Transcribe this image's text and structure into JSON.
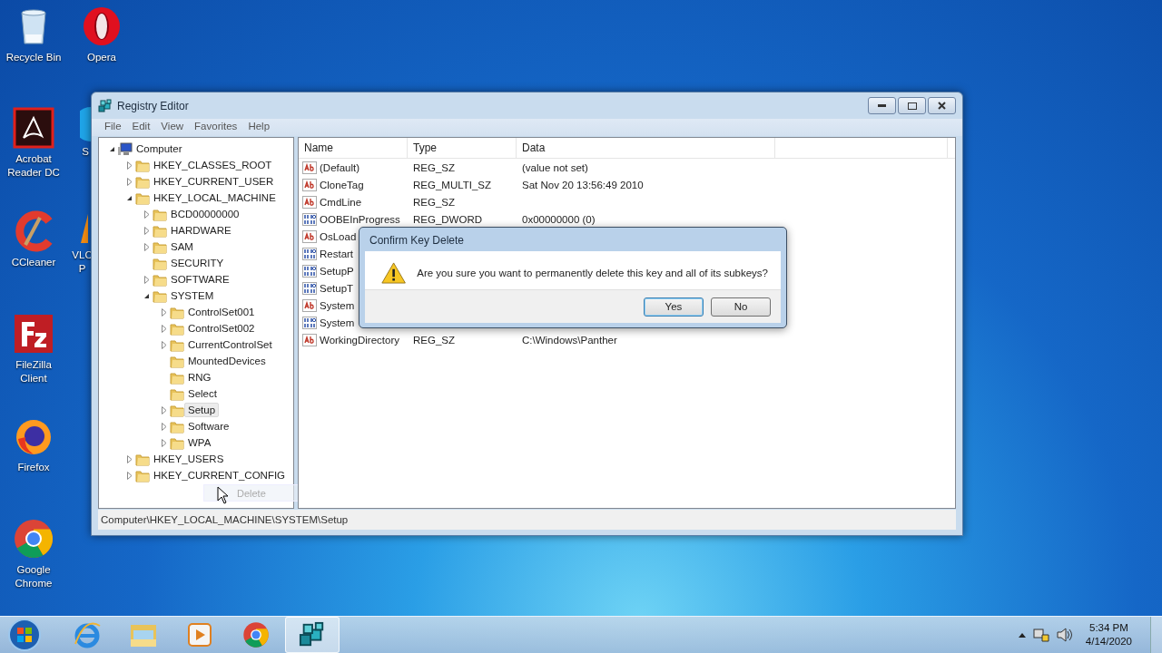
{
  "desktop_icons": [
    {
      "kind": "recycle",
      "lines": [
        "Recycle Bin"
      ]
    },
    {
      "kind": "acrobat",
      "lines": [
        "Acrobat",
        "Reader DC"
      ]
    },
    {
      "kind": "ccleaner",
      "lines": [
        "CCleaner"
      ]
    },
    {
      "kind": "filezilla",
      "lines": [
        "FileZilla",
        "Client"
      ]
    },
    {
      "kind": "firefox",
      "lines": [
        "Firefox"
      ]
    },
    {
      "kind": "chrome",
      "lines": [
        "Google",
        "Chrome"
      ]
    },
    {
      "kind": "opera",
      "lines": [
        "Opera"
      ]
    },
    {
      "kind": "skype",
      "lines": [
        "S"
      ]
    },
    {
      "kind": "vlc",
      "lines": [
        "VLC",
        "P"
      ]
    }
  ],
  "window": {
    "title": "Registry Editor",
    "menu": [
      "File",
      "Edit",
      "View",
      "Favorites",
      "Help"
    ],
    "tree": {
      "label": "Computer",
      "expanded": true,
      "children": [
        {
          "label": "HKEY_CLASSES_ROOT",
          "expanded": false
        },
        {
          "label": "HKEY_CURRENT_USER",
          "expanded": false
        },
        {
          "label": "HKEY_LOCAL_MACHINE",
          "expanded": true,
          "children": [
            {
              "label": "BCD00000000",
              "expanded": false
            },
            {
              "label": "HARDWARE",
              "expanded": false
            },
            {
              "label": "SAM",
              "expanded": false
            },
            {
              "label": "SECURITY"
            },
            {
              "label": "SOFTWARE",
              "expanded": false
            },
            {
              "label": "SYSTEM",
              "expanded": true,
              "children": [
                {
                  "label": "ControlSet001",
                  "expanded": false
                },
                {
                  "label": "ControlSet002",
                  "expanded": false
                },
                {
                  "label": "CurrentControlSet",
                  "expanded": false
                },
                {
                  "label": "MountedDevices"
                },
                {
                  "label": "RNG"
                },
                {
                  "label": "Select"
                },
                {
                  "label": "Setup",
                  "expanded": false,
                  "selected": true
                },
                {
                  "label": "Software",
                  "expanded": false
                },
                {
                  "label": "WPA",
                  "expanded": false
                }
              ]
            }
          ]
        },
        {
          "label": "HKEY_USERS",
          "expanded": false
        },
        {
          "label": "HKEY_CURRENT_CONFIG",
          "expanded": false
        }
      ]
    },
    "drag_ghost": "Delete",
    "columns": [
      "Name",
      "Type",
      "Data"
    ],
    "values": [
      {
        "kind": "string",
        "name": "(Default)",
        "type": "REG_SZ",
        "data": "(value not set)"
      },
      {
        "kind": "string",
        "name": "CloneTag",
        "type": "REG_MULTI_SZ",
        "data": "Sat Nov 20 13:56:49 2010"
      },
      {
        "kind": "string",
        "name": "CmdLine",
        "type": "REG_SZ"
      },
      {
        "kind": "binary",
        "name": "OOBEInProgress",
        "type": "REG_DWORD",
        "data": "0x00000000 (0)"
      },
      {
        "kind": "string",
        "name": "OsLoad"
      },
      {
        "kind": "binary",
        "name": "Restart"
      },
      {
        "kind": "binary",
        "name": "SetupP"
      },
      {
        "kind": "binary",
        "name": "SetupT"
      },
      {
        "kind": "string",
        "name": "System"
      },
      {
        "kind": "binary",
        "name": "System"
      },
      {
        "kind": "string",
        "name": "WorkingDirectory",
        "type": "REG_SZ",
        "data": "C:\\Windows\\Panther"
      }
    ],
    "status_bar": "Computer\\HKEY_LOCAL_MACHINE\\SYSTEM\\Setup"
  },
  "dialog": {
    "title": "Confirm Key Delete",
    "message": "Are you sure you want to permanently delete this key and all of its subkeys?",
    "buttons": [
      {
        "label": "Yes",
        "selected": true
      },
      {
        "label": "No",
        "selected": false
      }
    ]
  },
  "taskbar": {
    "apps": [
      {
        "kind": "ie",
        "selected": false
      },
      {
        "kind": "explorer",
        "selected": false
      },
      {
        "kind": "media",
        "selected": false
      },
      {
        "kind": "chrome",
        "selected": false
      },
      {
        "kind": "regedit",
        "selected": true
      }
    ],
    "time": "5:34 PM",
    "date": "4/14/2020"
  }
}
